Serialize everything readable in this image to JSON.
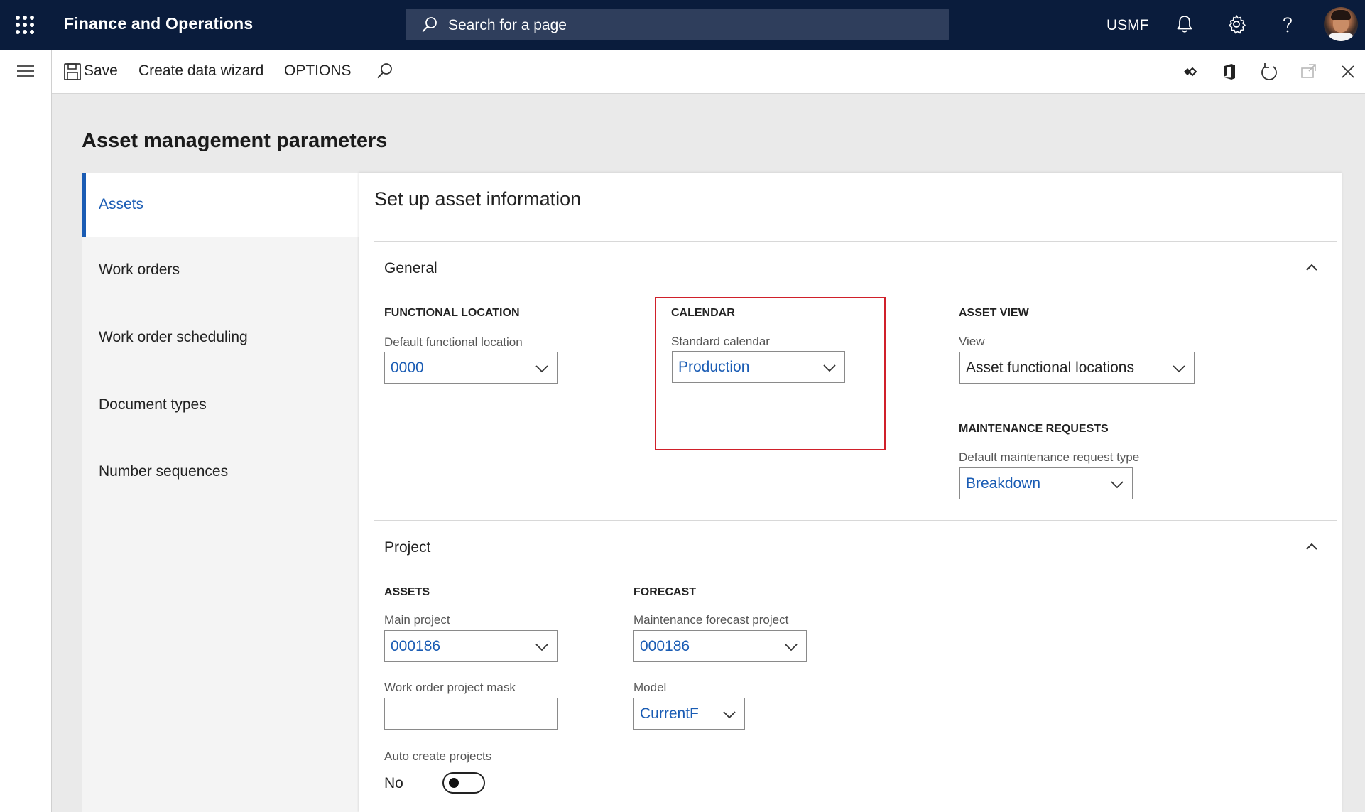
{
  "topbar": {
    "app_title": "Finance and Operations",
    "search_placeholder": "Search for a page",
    "company": "USMF"
  },
  "actionpane": {
    "save_label": "Save",
    "create_wizard_label": "Create data wizard",
    "options_label": "OPTIONS"
  },
  "page": {
    "title": "Asset management parameters"
  },
  "tabs": [
    {
      "label": "Assets"
    },
    {
      "label": "Work orders"
    },
    {
      "label": "Work order scheduling"
    },
    {
      "label": "Document types"
    },
    {
      "label": "Number sequences"
    }
  ],
  "content": {
    "title": "Set up asset information",
    "general": {
      "title": "General",
      "functional_location": {
        "group": "FUNCTIONAL LOCATION",
        "field_label": "Default functional location",
        "value": "0000"
      },
      "calendar": {
        "group": "CALENDAR",
        "field_label": "Standard calendar",
        "value": "Production"
      },
      "asset_view": {
        "group": "ASSET VIEW",
        "field_label": "View",
        "value": "Asset functional locations"
      },
      "maintenance_requests": {
        "group": "MAINTENANCE REQUESTS",
        "field_label": "Default maintenance request type",
        "value": "Breakdown"
      }
    },
    "project": {
      "title": "Project",
      "assets": {
        "group": "ASSETS",
        "main_project_label": "Main project",
        "main_project_value": "000186",
        "mask_label": "Work order project mask",
        "mask_value": "",
        "auto_create_label": "Auto create projects",
        "auto_create_value": "No"
      },
      "forecast": {
        "group": "FORECAST",
        "forecast_project_label": "Maintenance forecast project",
        "forecast_project_value": "000186",
        "model_label": "Model",
        "model_value": "CurrentF"
      }
    }
  },
  "colors": {
    "topbar_bg": "#0a1c3c",
    "accent": "#1a5cb4",
    "highlight": "#d0202a"
  }
}
